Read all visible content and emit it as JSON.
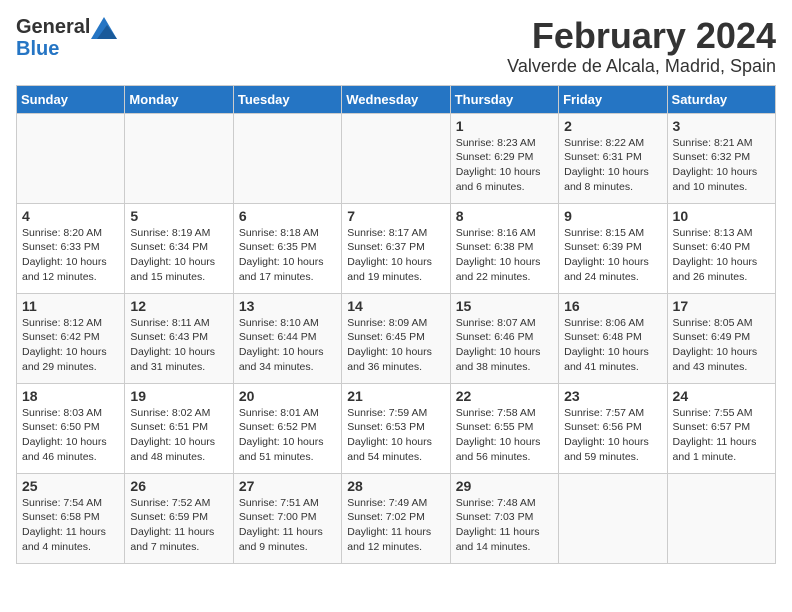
{
  "header": {
    "logo_line1": "General",
    "logo_line2": "Blue",
    "title": "February 2024",
    "subtitle": "Valverde de Alcala, Madrid, Spain"
  },
  "days_of_week": [
    "Sunday",
    "Monday",
    "Tuesday",
    "Wednesday",
    "Thursday",
    "Friday",
    "Saturday"
  ],
  "weeks": [
    [
      {
        "day": "",
        "info": ""
      },
      {
        "day": "",
        "info": ""
      },
      {
        "day": "",
        "info": ""
      },
      {
        "day": "",
        "info": ""
      },
      {
        "day": "1",
        "info": "Sunrise: 8:23 AM\nSunset: 6:29 PM\nDaylight: 10 hours\nand 6 minutes."
      },
      {
        "day": "2",
        "info": "Sunrise: 8:22 AM\nSunset: 6:31 PM\nDaylight: 10 hours\nand 8 minutes."
      },
      {
        "day": "3",
        "info": "Sunrise: 8:21 AM\nSunset: 6:32 PM\nDaylight: 10 hours\nand 10 minutes."
      }
    ],
    [
      {
        "day": "4",
        "info": "Sunrise: 8:20 AM\nSunset: 6:33 PM\nDaylight: 10 hours\nand 12 minutes."
      },
      {
        "day": "5",
        "info": "Sunrise: 8:19 AM\nSunset: 6:34 PM\nDaylight: 10 hours\nand 15 minutes."
      },
      {
        "day": "6",
        "info": "Sunrise: 8:18 AM\nSunset: 6:35 PM\nDaylight: 10 hours\nand 17 minutes."
      },
      {
        "day": "7",
        "info": "Sunrise: 8:17 AM\nSunset: 6:37 PM\nDaylight: 10 hours\nand 19 minutes."
      },
      {
        "day": "8",
        "info": "Sunrise: 8:16 AM\nSunset: 6:38 PM\nDaylight: 10 hours\nand 22 minutes."
      },
      {
        "day": "9",
        "info": "Sunrise: 8:15 AM\nSunset: 6:39 PM\nDaylight: 10 hours\nand 24 minutes."
      },
      {
        "day": "10",
        "info": "Sunrise: 8:13 AM\nSunset: 6:40 PM\nDaylight: 10 hours\nand 26 minutes."
      }
    ],
    [
      {
        "day": "11",
        "info": "Sunrise: 8:12 AM\nSunset: 6:42 PM\nDaylight: 10 hours\nand 29 minutes."
      },
      {
        "day": "12",
        "info": "Sunrise: 8:11 AM\nSunset: 6:43 PM\nDaylight: 10 hours\nand 31 minutes."
      },
      {
        "day": "13",
        "info": "Sunrise: 8:10 AM\nSunset: 6:44 PM\nDaylight: 10 hours\nand 34 minutes."
      },
      {
        "day": "14",
        "info": "Sunrise: 8:09 AM\nSunset: 6:45 PM\nDaylight: 10 hours\nand 36 minutes."
      },
      {
        "day": "15",
        "info": "Sunrise: 8:07 AM\nSunset: 6:46 PM\nDaylight: 10 hours\nand 38 minutes."
      },
      {
        "day": "16",
        "info": "Sunrise: 8:06 AM\nSunset: 6:48 PM\nDaylight: 10 hours\nand 41 minutes."
      },
      {
        "day": "17",
        "info": "Sunrise: 8:05 AM\nSunset: 6:49 PM\nDaylight: 10 hours\nand 43 minutes."
      }
    ],
    [
      {
        "day": "18",
        "info": "Sunrise: 8:03 AM\nSunset: 6:50 PM\nDaylight: 10 hours\nand 46 minutes."
      },
      {
        "day": "19",
        "info": "Sunrise: 8:02 AM\nSunset: 6:51 PM\nDaylight: 10 hours\nand 48 minutes."
      },
      {
        "day": "20",
        "info": "Sunrise: 8:01 AM\nSunset: 6:52 PM\nDaylight: 10 hours\nand 51 minutes."
      },
      {
        "day": "21",
        "info": "Sunrise: 7:59 AM\nSunset: 6:53 PM\nDaylight: 10 hours\nand 54 minutes."
      },
      {
        "day": "22",
        "info": "Sunrise: 7:58 AM\nSunset: 6:55 PM\nDaylight: 10 hours\nand 56 minutes."
      },
      {
        "day": "23",
        "info": "Sunrise: 7:57 AM\nSunset: 6:56 PM\nDaylight: 10 hours\nand 59 minutes."
      },
      {
        "day": "24",
        "info": "Sunrise: 7:55 AM\nSunset: 6:57 PM\nDaylight: 11 hours\nand 1 minute."
      }
    ],
    [
      {
        "day": "25",
        "info": "Sunrise: 7:54 AM\nSunset: 6:58 PM\nDaylight: 11 hours\nand 4 minutes."
      },
      {
        "day": "26",
        "info": "Sunrise: 7:52 AM\nSunset: 6:59 PM\nDaylight: 11 hours\nand 7 minutes."
      },
      {
        "day": "27",
        "info": "Sunrise: 7:51 AM\nSunset: 7:00 PM\nDaylight: 11 hours\nand 9 minutes."
      },
      {
        "day": "28",
        "info": "Sunrise: 7:49 AM\nSunset: 7:02 PM\nDaylight: 11 hours\nand 12 minutes."
      },
      {
        "day": "29",
        "info": "Sunrise: 7:48 AM\nSunset: 7:03 PM\nDaylight: 11 hours\nand 14 minutes."
      },
      {
        "day": "",
        "info": ""
      },
      {
        "day": "",
        "info": ""
      }
    ]
  ]
}
